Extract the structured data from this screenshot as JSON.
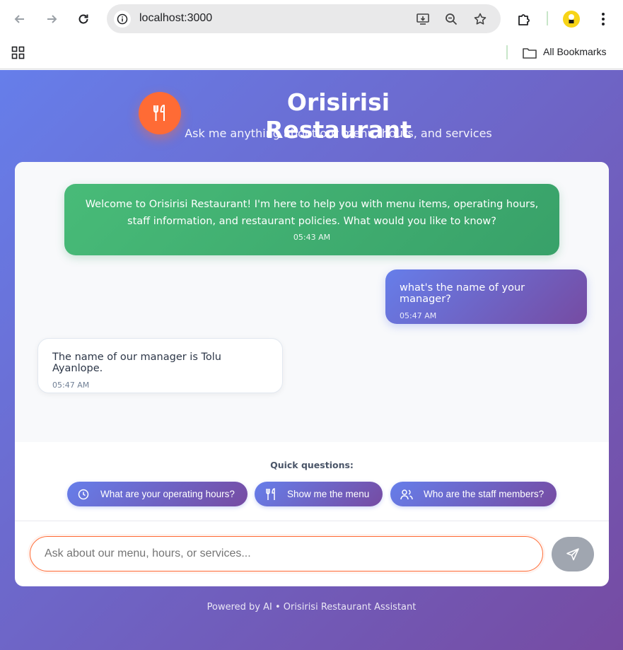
{
  "browser": {
    "url": "localhost:3000",
    "bookmarks_label": "All Bookmarks"
  },
  "header": {
    "title": "Orisirisi Restaurant",
    "subtitle": "Ask me anything about our menu, hours, and services"
  },
  "messages": [
    {
      "role": "assistant",
      "text": "Welcome to Orisirisi Restaurant! I'm here to help you with menu items, operating hours, staff information, and restaurant policies. What would you like to know?",
      "time": "05:43 AM"
    },
    {
      "role": "user",
      "text": "what's the name of your manager?",
      "time": "05:47 AM"
    },
    {
      "role": "assistant",
      "text": "The name of our manager is Tolu Ayanlope.",
      "time": "05:47 AM"
    }
  ],
  "quick": {
    "label": "Quick questions:",
    "items": [
      {
        "label": "What are your operating hours?",
        "icon": "clock-icon"
      },
      {
        "label": "Show me the menu",
        "icon": "utensils-icon"
      },
      {
        "label": "Who are the staff members?",
        "icon": "users-icon"
      }
    ]
  },
  "input": {
    "placeholder": "Ask about our menu, hours, or services...",
    "value": ""
  },
  "footer": "Powered by AI • Orisirisi Restaurant Assistant",
  "colors": {
    "gradient_start": "#667eea",
    "gradient_end": "#764ba2",
    "accent": "#ff6b35",
    "welcome": "#48bb78"
  }
}
